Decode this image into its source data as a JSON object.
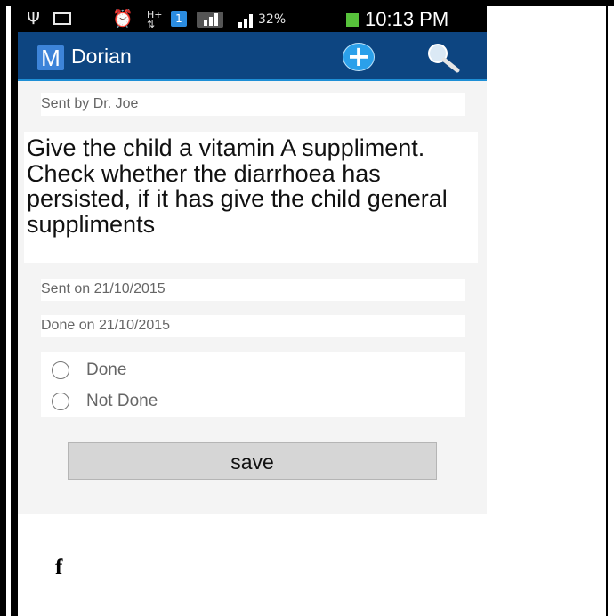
{
  "status_bar": {
    "battery_percent": "32%",
    "time": "10:13 PM",
    "icons": [
      "usb-icon",
      "image-icon",
      "alarm-icon",
      "hplus-data-icon",
      "notification-badge-icon",
      "signal-icon",
      "signal-bars-icon",
      "battery-charging-icon"
    ],
    "badge_number": "1"
  },
  "action_bar": {
    "logo_letter": "M",
    "title": "Dorian",
    "add_icon": "plus-circle-icon",
    "search_icon": "search-icon",
    "background": "#0d4581"
  },
  "task": {
    "sent_by": "Sent by Dr. Joe",
    "message": "Give the child a vitamin A suppliment. Check whether the diarrhoea has persisted, if it has give the child general suppliments",
    "sent_on": "Sent on 21/10/2015",
    "done_on": "Done on 21/10/2015"
  },
  "status_options": [
    {
      "label": "Done",
      "selected": false
    },
    {
      "label": "Not Done",
      "selected": false
    }
  ],
  "save_label": "save",
  "figure_caption": "f"
}
